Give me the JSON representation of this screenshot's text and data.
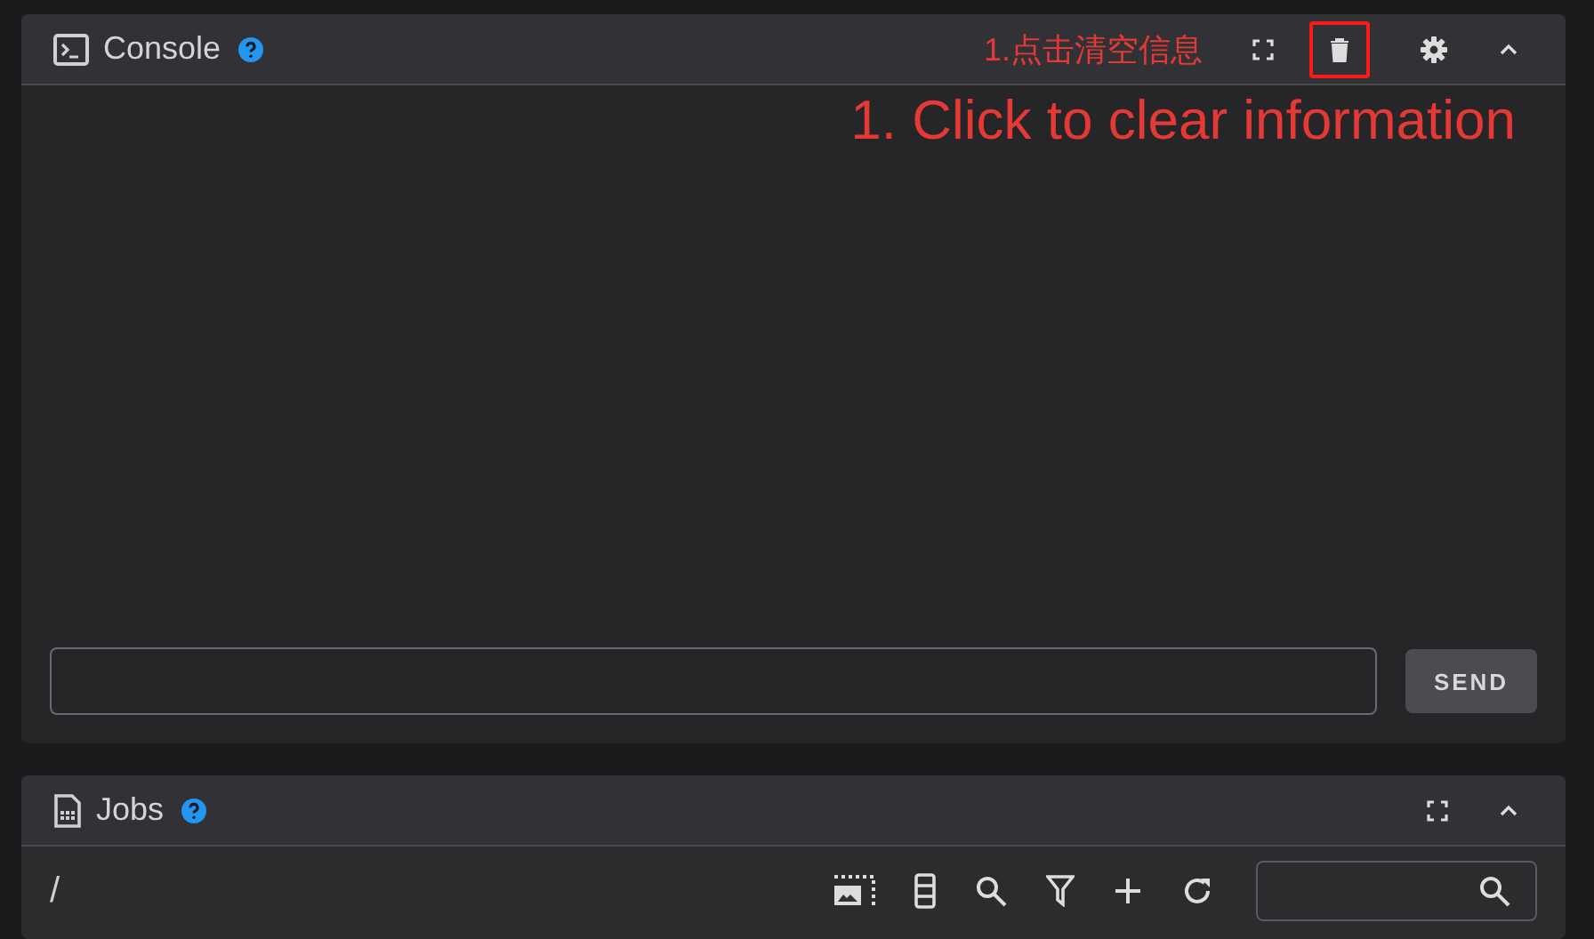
{
  "console": {
    "title": "Console",
    "annotation_cn": "1.点击清空信息",
    "annotation_en": "1. Click to clear information",
    "trash_highlighted": true,
    "send_label": "SEND"
  },
  "jobs": {
    "title": "Jobs",
    "path": "/"
  }
}
